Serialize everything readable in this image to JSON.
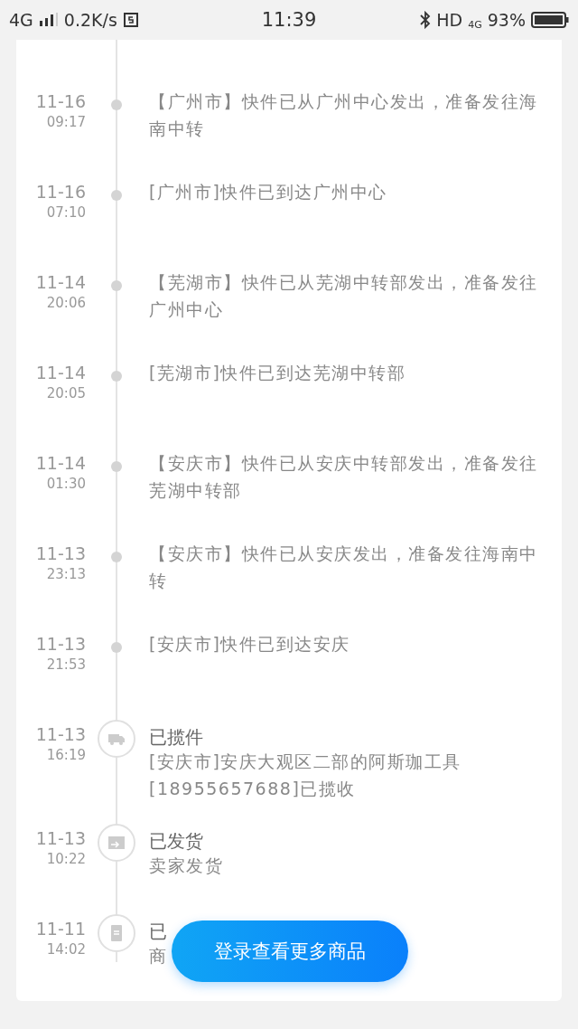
{
  "status_bar": {
    "network": "4G",
    "speed": "0.2K/s",
    "time": "11:39",
    "hd": "HD",
    "net_small": "4G",
    "battery": "93%"
  },
  "timeline": [
    {
      "kind": "event",
      "date": "11-16",
      "time": "09:17",
      "text": "【广州市】快件已从广州中心发出，准备发往海南中转"
    },
    {
      "kind": "event",
      "date": "11-16",
      "time": "07:10",
      "text": "[广州市]快件已到达广州中心"
    },
    {
      "kind": "event",
      "date": "11-14",
      "time": "20:06",
      "text": "【芜湖市】快件已从芜湖中转部发出，准备发往广州中心"
    },
    {
      "kind": "event",
      "date": "11-14",
      "time": "20:05",
      "text": "[芜湖市]快件已到达芜湖中转部"
    },
    {
      "kind": "event",
      "date": "11-14",
      "time": "01:30",
      "text": "【安庆市】快件已从安庆中转部发出，准备发往芜湖中转部"
    },
    {
      "kind": "event",
      "date": "11-13",
      "time": "23:13",
      "text": "【安庆市】快件已从安庆发出，准备发往海南中转"
    },
    {
      "kind": "event",
      "date": "11-13",
      "time": "21:53",
      "text": "[安庆市]快件已到达安庆"
    },
    {
      "kind": "milestone",
      "date": "11-13",
      "time": "16:19",
      "title": "已揽件",
      "text": "[安庆市]安庆大观区二部的阿斯珈工具[18955657688]已揽收"
    },
    {
      "kind": "milestone",
      "date": "11-13",
      "time": "10:22",
      "title": "已发货",
      "text": "卖家发货"
    },
    {
      "kind": "milestone",
      "date": "11-11",
      "time": "14:02",
      "title": "已",
      "text": "商"
    }
  ],
  "login_button": "登录查看更多商品"
}
